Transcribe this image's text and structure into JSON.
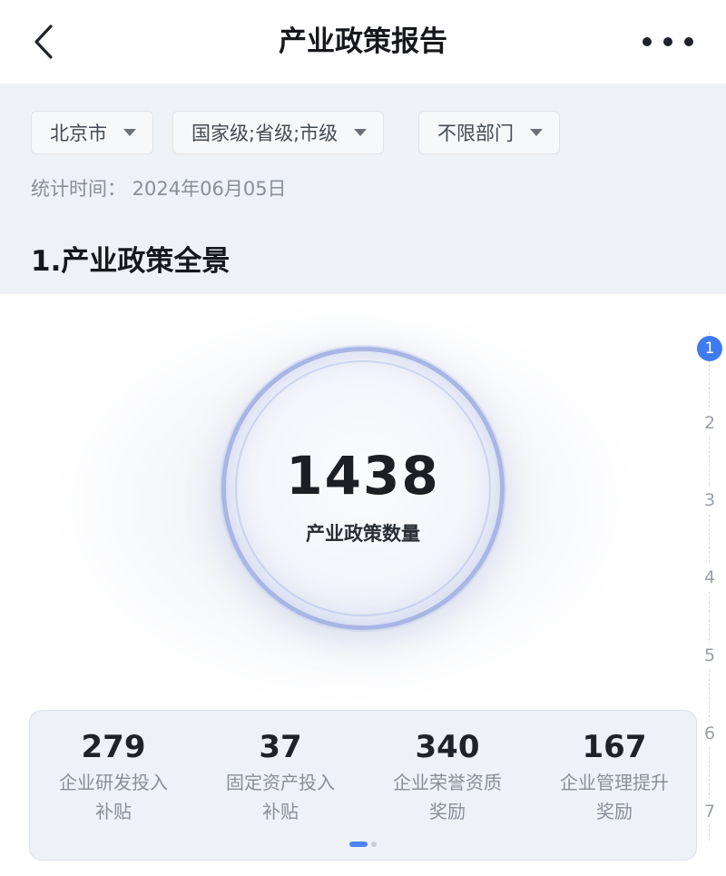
{
  "header": {
    "title": "产业政策报告"
  },
  "filters": [
    {
      "label": "北京市"
    },
    {
      "label": "国家级;省级;市级"
    },
    {
      "label": "不限部门"
    }
  ],
  "stat_time": "统计时间：  2024年06月05日",
  "section_title": "1.产业政策全景",
  "hero": {
    "value": "1438",
    "label": "产业政策数量"
  },
  "pager": [
    "1",
    "2",
    "3",
    "4",
    "5",
    "6",
    "7"
  ],
  "pager_active": "1",
  "stats": [
    {
      "value": "279",
      "line1": "企业研发投入",
      "line2": "补贴"
    },
    {
      "value": "37",
      "line1": "固定资产投入",
      "line2": "补贴"
    },
    {
      "value": "340",
      "line1": "企业荣誉资质",
      "line2": "奖励"
    },
    {
      "value": "167",
      "line1": "企业管理提升",
      "line2": "奖励"
    }
  ],
  "carousel": {
    "pages": 2,
    "active": 1
  }
}
